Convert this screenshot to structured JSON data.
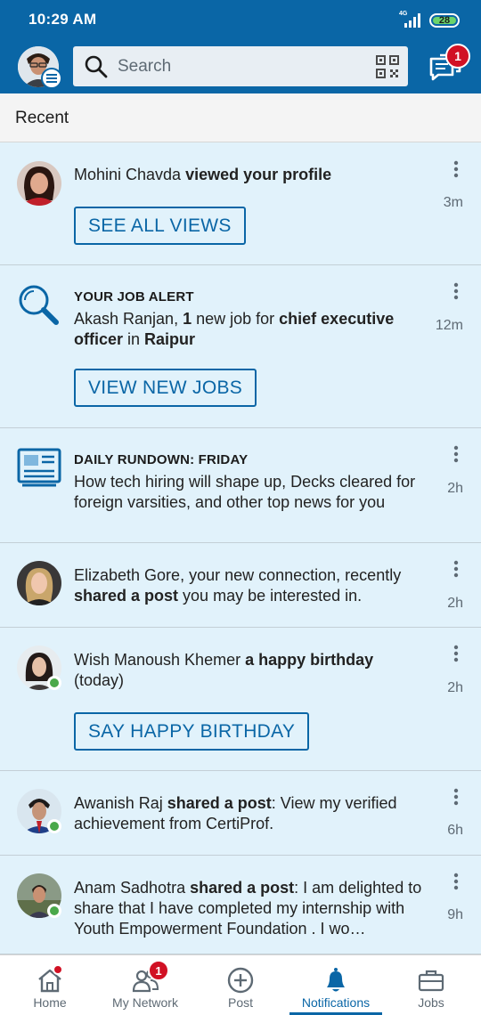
{
  "status_bar": {
    "time": "10:29 AM",
    "network": "4G",
    "battery": "28"
  },
  "header": {
    "search_placeholder": "Search",
    "messages_badge": "1"
  },
  "section": {
    "title": "Recent"
  },
  "notifications": [
    {
      "actor": "Mohini Chavda",
      "action": " viewed your profile",
      "time": "3m",
      "button": "SEE ALL VIEWS"
    },
    {
      "kicker": "YOUR JOB ALERT",
      "t1": "Akash Ranjan, ",
      "b1": "1",
      "t2": " new job for ",
      "b2": "chief executive officer",
      "t3": " in ",
      "b3": "Raipur",
      "time": "12m",
      "button": "VIEW NEW JOBS"
    },
    {
      "kicker": "DAILY RUNDOWN: FRIDAY",
      "text": "How tech hiring will shape up, Decks cleared for foreign varsities, and other top news for you",
      "time": "2h"
    },
    {
      "t1": "Elizabeth Gore, your new connection, recently ",
      "b1": "shared a post",
      "t2": " you may be interested in.",
      "time": "2h"
    },
    {
      "t1": "Wish Manoush Khemer ",
      "b1": "a happy birthday",
      "t2": " (today)",
      "time": "2h",
      "button": "SAY HAPPY BIRTHDAY"
    },
    {
      "t1": "Awanish Raj ",
      "b1": "shared a post",
      "t2": ": View my verified achievement from CertiProf.",
      "time": "6h"
    },
    {
      "t1": "Anam Sadhotra ",
      "b1": "shared a post",
      "t2": ": I am delighted to share that I have completed my internship with Youth Empowerment Foundation . I wo…",
      "time": "9h"
    }
  ],
  "nav": {
    "home": "Home",
    "network": "My Network",
    "network_badge": "1",
    "post": "Post",
    "notifications": "Notifications",
    "jobs": "Jobs"
  },
  "colors": {
    "brand": "#0a66a6",
    "unread_bg": "#e1f2fb",
    "badge": "#d11124"
  }
}
